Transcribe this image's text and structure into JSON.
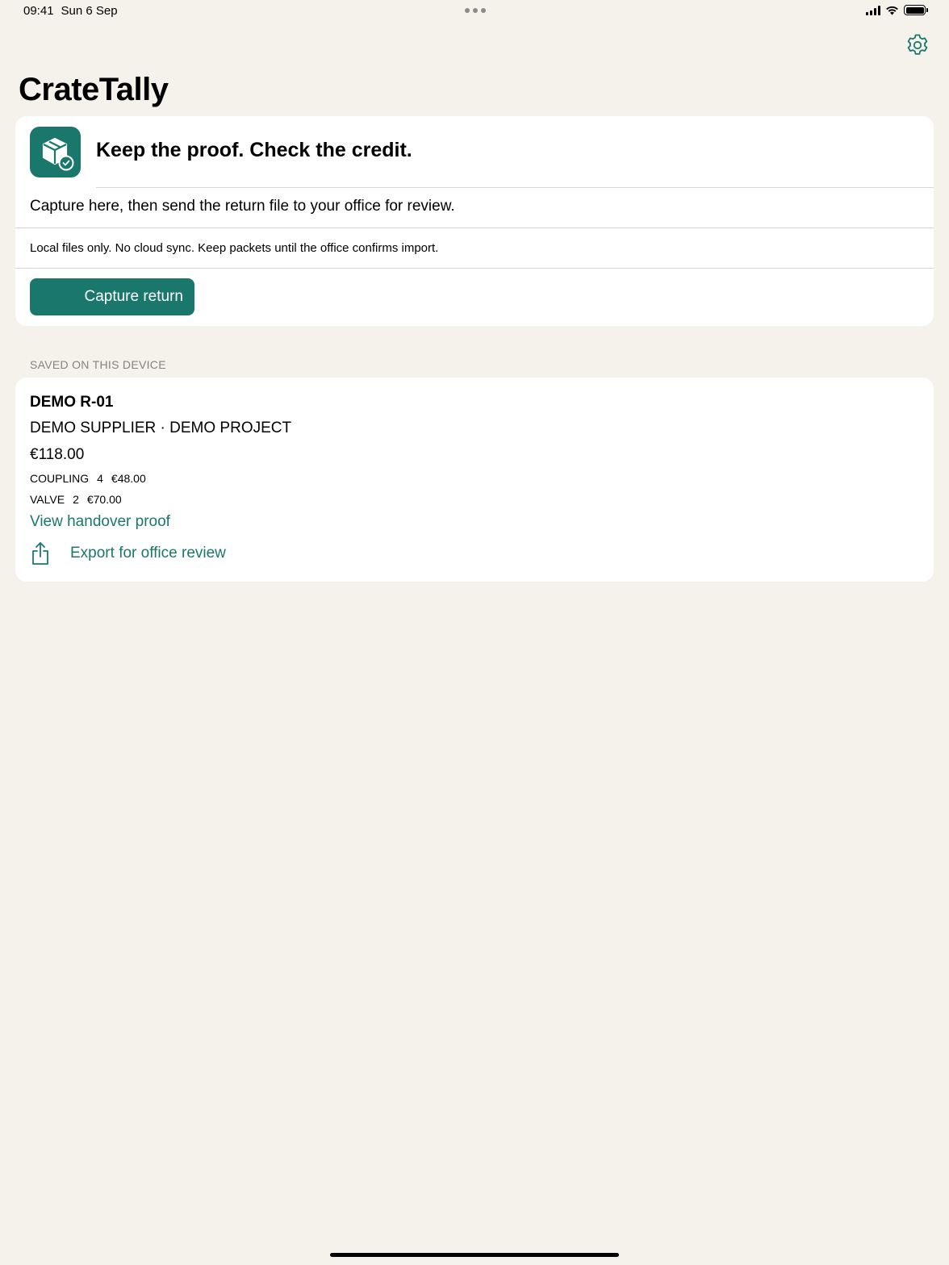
{
  "status_bar": {
    "time": "09:41",
    "date": "Sun 6 Sep",
    "icons": [
      "signal-icon",
      "wifi-icon",
      "battery-icon"
    ]
  },
  "header": {
    "title": "CrateTally",
    "settings_icon": "gear-icon"
  },
  "hero": {
    "icon": "package-check-icon",
    "headline": "Keep the proof. Check the credit.",
    "subtitle": "Capture here, then send the return file to your office for review.",
    "note": "Local files only. No cloud sync. Keep packets until the office confirms import.",
    "capture_label": "Capture return"
  },
  "saved": {
    "section_title": "SAVED ON THIS DEVICE",
    "records": [
      {
        "id": "DEMO R-01",
        "supplier_project": "DEMO SUPPLIER · DEMO PROJECT",
        "total": "€118.00",
        "lines": [
          {
            "item": "COUPLING",
            "qty": "4",
            "amount": "€48.00"
          },
          {
            "item": "VALVE",
            "qty": "2",
            "amount": "€70.00"
          }
        ],
        "view_proof_label": "View handover proof",
        "export_label": "Export for office review",
        "export_icon": "share-icon"
      }
    ]
  },
  "colors": {
    "accent": "#1A776B",
    "background": "#F5F2EC",
    "card": "#FFFFFF",
    "muted": "#85827D"
  }
}
